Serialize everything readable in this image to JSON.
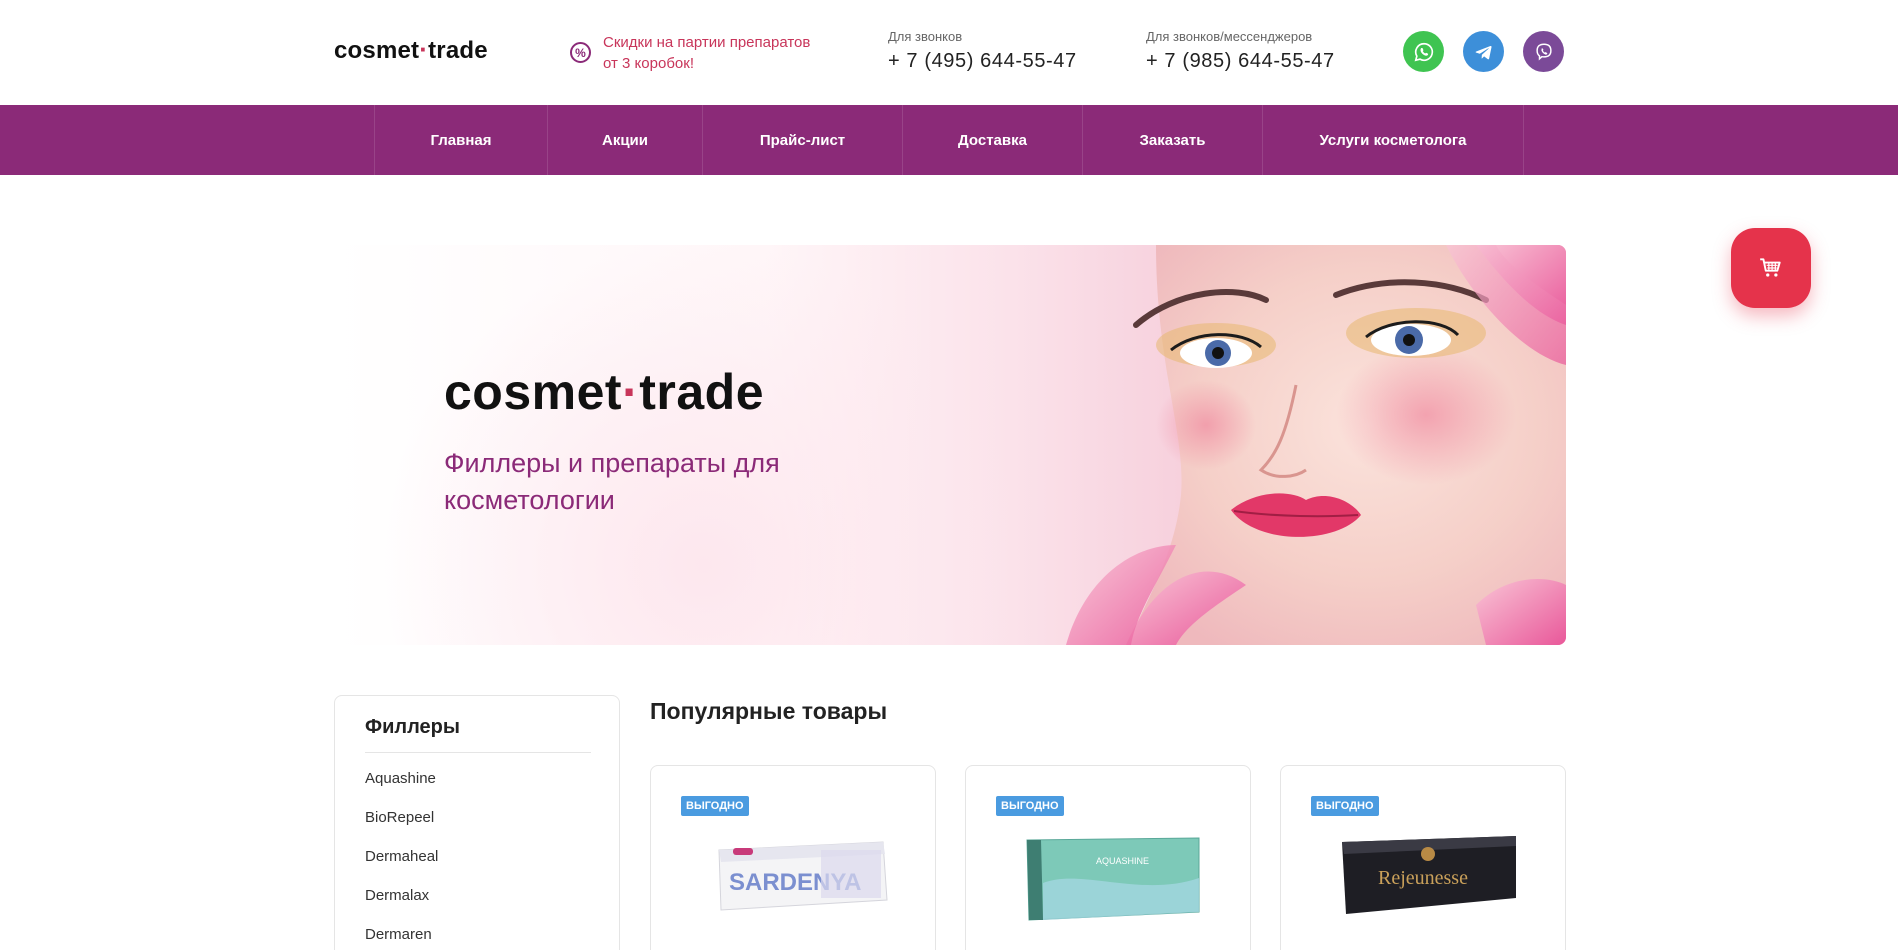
{
  "header": {
    "logo_left": "cosmet",
    "logo_dot": "·",
    "logo_right": "trade",
    "promo_icon": "%",
    "promo_text": "Скидки на партии препаратов от 3 коробок!",
    "phone1_label": "Для звонков",
    "phone1": "+ 7 (495) 644-55-47",
    "phone2_label": "Для звонков/мессенджеров",
    "phone2": "+ 7 (985) 644-55-47",
    "socials": [
      {
        "icon": "whatsapp-icon",
        "color": "#3fc451"
      },
      {
        "icon": "telegram-icon",
        "color": "#3d8fd9"
      },
      {
        "icon": "viber-icon",
        "color": "#7b4a98"
      }
    ]
  },
  "nav": {
    "items": [
      "Главная",
      "Акции",
      "Прайс-лист",
      "Доставка",
      "Заказать",
      "Услуги косметолога"
    ]
  },
  "hero": {
    "logo_left": "cosmet",
    "logo_dot": "·",
    "logo_right": "trade",
    "subtitle": "Филлеры и препараты для косметологии"
  },
  "sidebar": {
    "title": "Филлеры",
    "items": [
      "Aquashine",
      "BioRepeel",
      "Dermaheal",
      "Dermalax",
      "Dermaren"
    ]
  },
  "popular": {
    "title": "Популярные товары",
    "products": [
      {
        "badge": "ВЫГОДНО",
        "brand": "SARDENYA"
      },
      {
        "badge": "ВЫГОДНО",
        "brand": "AQUASHINE"
      },
      {
        "badge": "ВЫГОДНО",
        "brand": "Rejeunesse"
      }
    ]
  },
  "colors": {
    "brand_purple": "#8b2a78",
    "accent_red": "#c8355a",
    "cart_red": "#e5334b",
    "badge_blue": "#4a9be0"
  }
}
